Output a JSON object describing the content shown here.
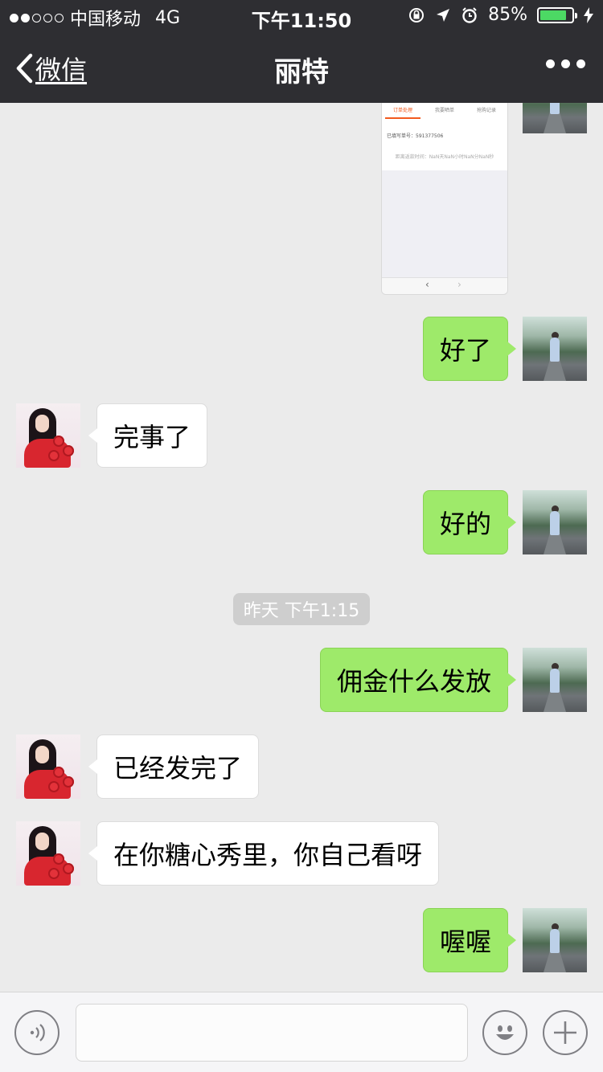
{
  "status_bar": {
    "carrier": "中国移动",
    "network": "4G",
    "time": "下午11:50",
    "battery_percent": "85%",
    "battery_level": 0.85,
    "battery_color": "#4cd964"
  },
  "nav": {
    "back_label": "微信",
    "title": "丽特",
    "more_icon": "more-dots-icon"
  },
  "screenshot_message": {
    "tabs": [
      "订单处理",
      "我要晒单",
      "抢购记录"
    ],
    "order_line": "已填写单号：591377506",
    "time_line": "距离返款时间：NaN天NaN小时NaN分NaN秒"
  },
  "messages": [
    {
      "side": "right",
      "text": "好了"
    },
    {
      "side": "left",
      "text": "完事了"
    },
    {
      "side": "right",
      "text": "好的"
    },
    {
      "side": "timestamp",
      "text": "昨天 下午1:15"
    },
    {
      "side": "right",
      "text": "佣金什么发放"
    },
    {
      "side": "left",
      "text": "已经发完了"
    },
    {
      "side": "left",
      "text": "在你糖心秀里，你自己看呀"
    },
    {
      "side": "right",
      "text": "喔喔"
    }
  ],
  "input_bar": {
    "voice_icon": "voice-icon",
    "emoji_icon": "emoji-icon",
    "plus_icon": "plus-icon",
    "placeholder": ""
  },
  "colors": {
    "my_bubble": "#9eea6a",
    "their_bubble": "#ffffff",
    "nav_background": "#2e2e32",
    "chat_background": "#ebebeb"
  }
}
